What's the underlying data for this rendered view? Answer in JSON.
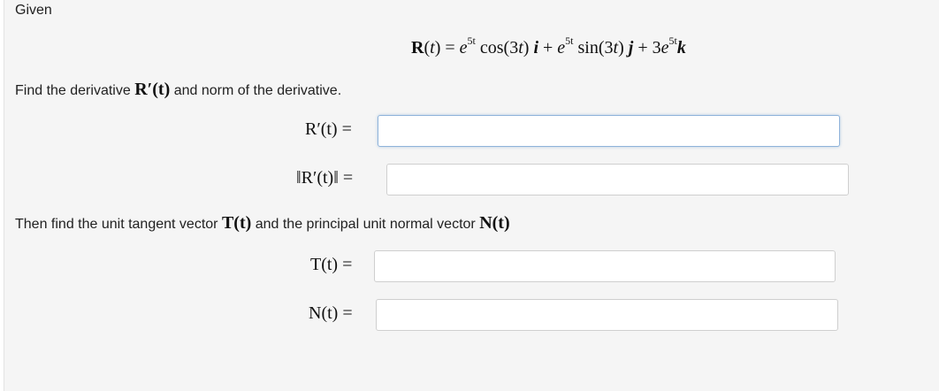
{
  "header": {
    "given_label": "Given"
  },
  "given_formula": {
    "lhs": "R",
    "paren_open": "(",
    "var": "t",
    "paren_close_eq": ") = ",
    "e1": "e",
    "exp1": "5t",
    "cos_part": " cos(3",
    "t1": "t",
    "close1": ") ",
    "i": "i",
    "plus1": " + ",
    "e2": "e",
    "exp2": "5t",
    "sin_part": " sin(3",
    "t2": "t",
    "close2": ") ",
    "j": "j",
    "plus2": " + 3",
    "e3": "e",
    "exp3": "5t",
    "k": "k"
  },
  "instruction1": {
    "before": "Find the derivative ",
    "math": "R′(t)",
    "after": " and norm of the derivative."
  },
  "instruction2": {
    "before": "Then find the unit tangent vector ",
    "math1": "T(t)",
    "middle": " and the principal unit normal vector ",
    "math2": "N(t)"
  },
  "fields": {
    "derivative": {
      "label": "R′(t) =",
      "value": ""
    },
    "norm": {
      "label": "‖R′(t)‖ =",
      "value": ""
    },
    "tangent": {
      "label": "T(t) =",
      "value": ""
    },
    "normal": {
      "label": "N(t) =",
      "value": ""
    }
  }
}
